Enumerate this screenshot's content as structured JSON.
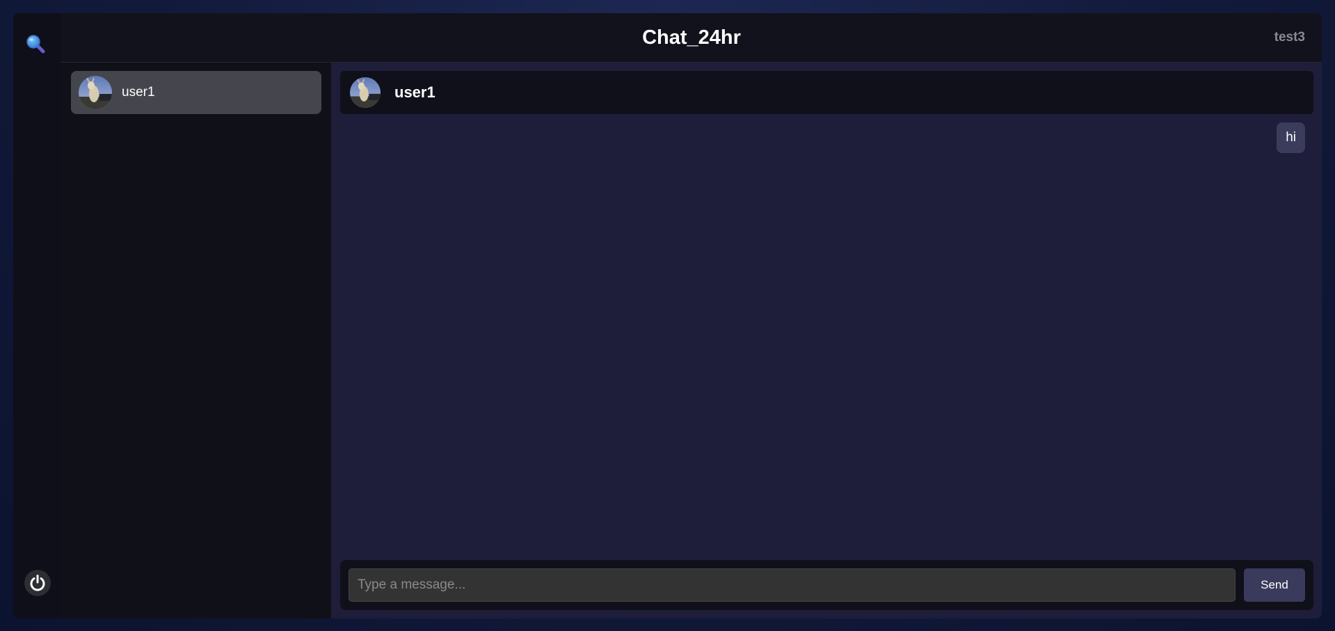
{
  "app": {
    "title": "Chat_24hr",
    "current_user": "test3"
  },
  "rail": {
    "search_icon": "search-icon",
    "logout_icon": "power-icon"
  },
  "contacts": [
    {
      "name": "user1",
      "avatar": "goat-photo-avatar"
    }
  ],
  "chat": {
    "partner_name": "user1",
    "messages": [
      {
        "text": "hi",
        "direction": "outgoing"
      }
    ]
  },
  "composer": {
    "placeholder": "Type a message...",
    "value": "",
    "send_label": "Send"
  },
  "colors": {
    "app_bg": "#0f0f19",
    "chat_bg": "#1e1e3a",
    "bubble_bg": "#3b3c5c",
    "contact_selected_bg": "#45454e",
    "send_button_bg": "#3a3a5c"
  }
}
